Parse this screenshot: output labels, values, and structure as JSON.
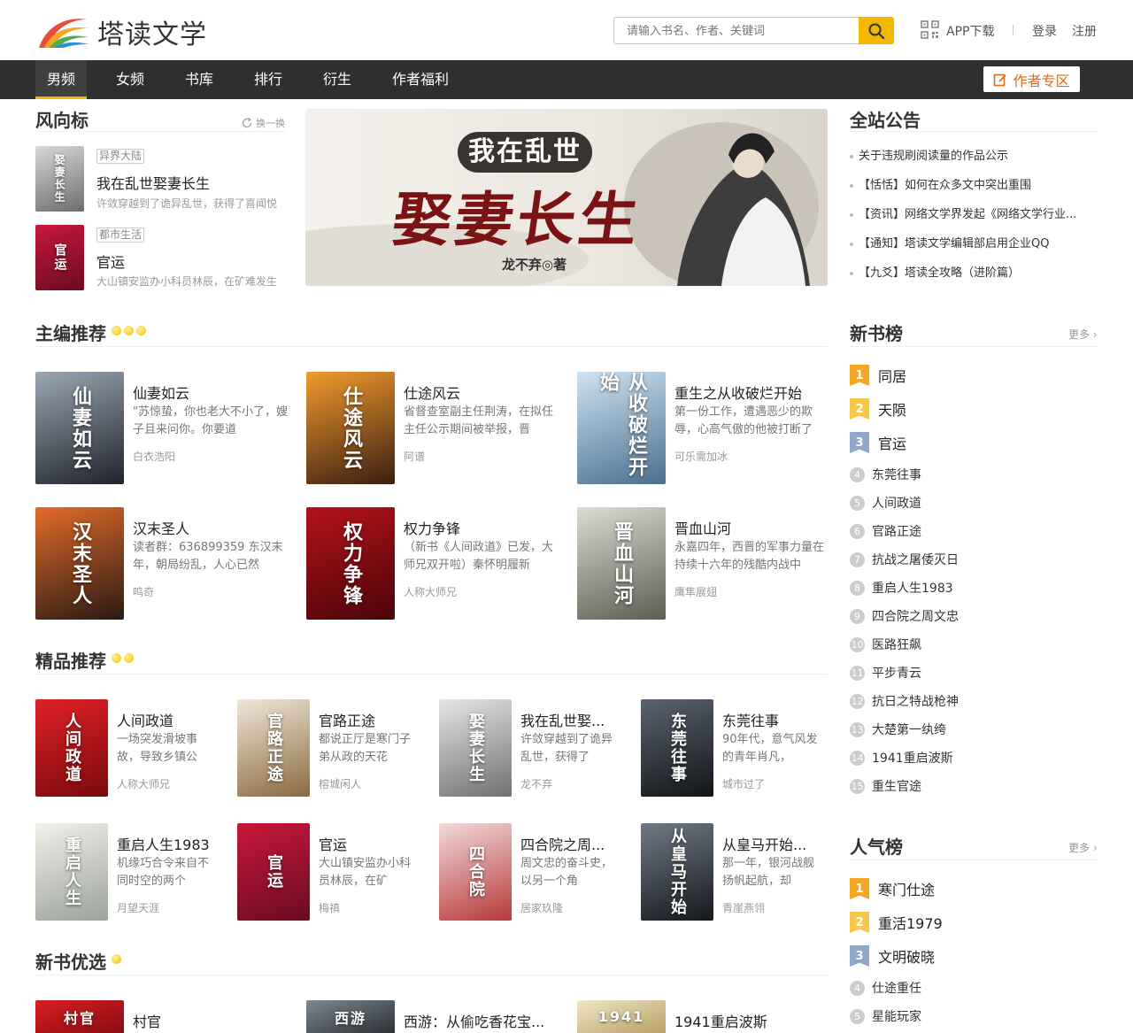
{
  "header": {
    "logo_text": "塔读文学",
    "search_placeholder": "请输入书名、作者、关键词",
    "app_label": "APP下载",
    "login": "登录",
    "register": "注册"
  },
  "nav": {
    "items": [
      "男频",
      "女频",
      "书库",
      "排行",
      "衍生",
      "作者福利"
    ],
    "active": "男频",
    "author_zone": "作者专区"
  },
  "trend": {
    "title": "风向标",
    "refresh": "换一换",
    "items": [
      {
        "tag": "异界大陆",
        "title": "我在乱世娶妻长生",
        "desc": "许敛穿越到了诡异乱世，获得了喜闻悦",
        "cover_text": "娶妻长生",
        "colors": [
          "#d8d8d8",
          "#6d6d6d"
        ]
      },
      {
        "tag": "都市生活",
        "title": "官运",
        "desc": "大山镇安监办小科员林辰，在矿难发生",
        "cover_text": "官运",
        "colors": [
          "#c7183b",
          "#6b0b20"
        ]
      }
    ]
  },
  "banner": {
    "line1": "我在乱世",
    "line2": "娶妻长生",
    "author": "龙不弃◎著"
  },
  "announce": {
    "title": "全站公告",
    "items": [
      "关于违规刷阅读量的作品公示",
      "【恬恬】如何在众多文中突出重围",
      "【资讯】网络文学界发起《网络文学行业...",
      "【通知】塔读文学编辑部启用企业QQ",
      "【九爻】塔读全攻略（进阶篇）"
    ]
  },
  "editor_picks": {
    "title": "主编推荐",
    "books": [
      {
        "title": "仙妻如云",
        "desc": "\"苏惊蛰，你也老大不小了，嫂子且来问你。你要道",
        "author": "白衣浩阳",
        "cover_text": "仙妻如云",
        "colors": [
          "#9aa7b3",
          "#1f232c"
        ]
      },
      {
        "title": "仕途风云",
        "desc": "省督查室副主任荆涛，在拟任主任公示期间被举报，晋",
        "author": "阿谱",
        "cover_text": "仕途风云",
        "colors": [
          "#f29a2e",
          "#3a1e10"
        ]
      },
      {
        "title": "重生之从收破烂开始",
        "desc": "第一份工作，遭遇恶少的欺辱，心高气傲的他被打断了",
        "author": "可乐需加冰",
        "cover_text": "从收破烂开始",
        "colors": [
          "#cfe3f2",
          "#4b6f8e"
        ]
      },
      {
        "title": "汉末圣人",
        "desc": "读者群：636899359 东汉末年，朝局纷乱，人心已然",
        "author": "鸣奇",
        "cover_text": "汉末圣人",
        "colors": [
          "#e26b2a",
          "#2a1a14"
        ]
      },
      {
        "title": "权力争锋",
        "desc": "（新书《人间政道》已发，大师兄双开啦）秦怀明履新",
        "author": "人称大师兄",
        "cover_text": "权力争锋",
        "colors": [
          "#b4121b",
          "#4a0508"
        ]
      },
      {
        "title": "晋血山河",
        "desc": "永嘉四年，西晋的军事力量在持续十六年的残酷内战中",
        "author": "鹰隼展翅",
        "cover_text": "晋血山河",
        "colors": [
          "#d9ddd2",
          "#5b5f52"
        ]
      }
    ]
  },
  "quality_picks": {
    "title": "精品推荐",
    "books": [
      {
        "title": "人间政道",
        "desc": "一场突发滑坡事故，导致乡镇公",
        "author": "人称大师兄",
        "cover_text": "人间政道",
        "colors": [
          "#e02026",
          "#7a0a0e"
        ]
      },
      {
        "title": "官路正途",
        "desc": "都说正厅是寒门子弟从政的天花",
        "author": "榕城闲人",
        "cover_text": "官路正途",
        "colors": [
          "#f0e7d8",
          "#8a6a40"
        ]
      },
      {
        "title": "我在乱世娶...",
        "desc": "许敛穿越到了诡异乱世，获得了",
        "author": "龙不弃",
        "cover_text": "娶妻长生",
        "colors": [
          "#e6e6e6",
          "#707070"
        ]
      },
      {
        "title": "东莞往事",
        "desc": "90年代，意气风发的青年肖凡，",
        "author": "城市过了",
        "cover_text": "东莞往事",
        "colors": [
          "#5b6470",
          "#121418"
        ]
      },
      {
        "title": "重启人生1983",
        "desc": "机缘巧合令来自不同时空的两个",
        "author": "月望天涯",
        "cover_text": "重启人生",
        "colors": [
          "#f2f0ea",
          "#9aa39a"
        ]
      },
      {
        "title": "官运",
        "desc": "大山镇安监办小科员林辰，在矿",
        "author": "梅禛",
        "cover_text": "官运",
        "colors": [
          "#c7183b",
          "#6b0b20"
        ]
      },
      {
        "title": "四合院之周...",
        "desc": "周文忠的奋斗史，以另一个角",
        "author": "居家玖隆",
        "cover_text": "四合院",
        "colors": [
          "#f3d9d9",
          "#b73a3a"
        ]
      },
      {
        "title": "从皇马开始...",
        "desc": "那一年，银河战舰扬帆起航，却",
        "author": "青崖燕翎",
        "cover_text": "从皇马开始",
        "colors": [
          "#707a86",
          "#15181d"
        ]
      }
    ]
  },
  "new_picks": {
    "title": "新书优选",
    "books": [
      {
        "title": "村官",
        "cover_text": "村官",
        "colors": [
          "#d91d24",
          "#8a0d12"
        ]
      },
      {
        "title": "西游：从偷吃香花宝...",
        "cover_text": "西游",
        "colors": [
          "#7f8890",
          "#2a3036"
        ]
      },
      {
        "title": "1941重启波斯",
        "cover_text": "1941",
        "colors": [
          "#efe6c8",
          "#b8a066"
        ]
      }
    ]
  },
  "new_rank": {
    "title": "新书榜",
    "more": "更多",
    "items": [
      "同居",
      "天陨",
      "官运",
      "东莞往事",
      "人间政道",
      "官路正途",
      "抗战之屠倭灭日",
      "重启人生1983",
      "四合院之周文忠",
      "医路狂飙",
      "平步青云",
      "抗日之特战枪神",
      "大楚第一纨绔",
      "1941重启波斯",
      "重生官途"
    ]
  },
  "popular_rank": {
    "title": "人气榜",
    "more": "更多",
    "items": [
      "寒门仕途",
      "重活1979",
      "文明破晓",
      "仕途重任",
      "星能玩家"
    ]
  },
  "colors": {
    "accent": "#f5b800",
    "nav_bg": "#2f2f2f",
    "rank1": "#f5a623",
    "rank2": "#f8c84a",
    "rank3": "#8fa7c9"
  }
}
